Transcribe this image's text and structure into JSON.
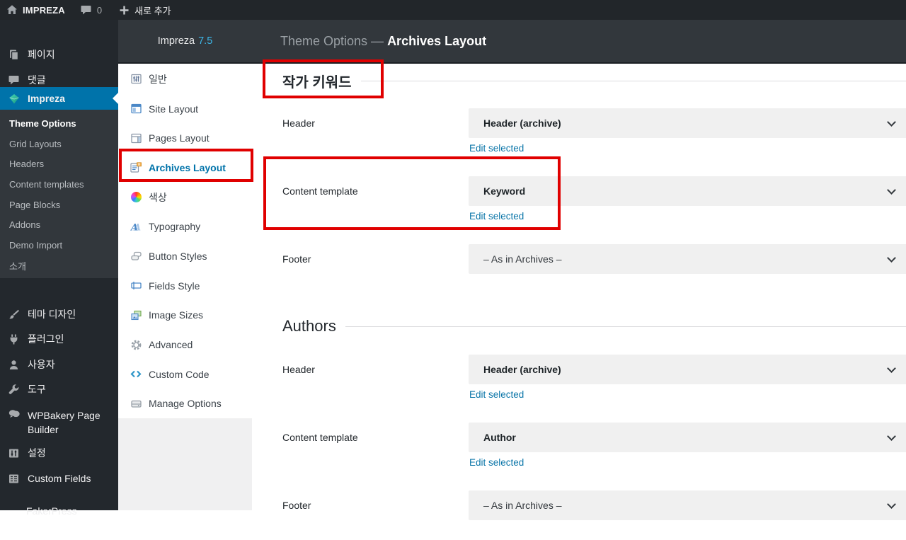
{
  "admin_bar": {
    "site_name": "IMPREZA",
    "comments_count": "0",
    "new_button": "새로 추가"
  },
  "admin_sidebar": {
    "top_items": [
      {
        "label": "페이지"
      },
      {
        "label": "댓글"
      }
    ],
    "impreza_label": "Impreza",
    "impreza_submenu": [
      "Theme Options",
      "Grid Layouts",
      "Headers",
      "Content templates",
      "Page Blocks",
      "Addons",
      "Demo Import",
      "소개"
    ],
    "active_submenu": "Theme Options",
    "lower_items": [
      {
        "label": "테마 디자인"
      },
      {
        "label": "플러그인"
      },
      {
        "label": "사용자"
      },
      {
        "label": "도구"
      },
      {
        "label": "WPBakery Page Builder"
      },
      {
        "label": "설정"
      },
      {
        "label": "Custom Fields"
      },
      {
        "label": "FakerPress"
      }
    ]
  },
  "theme_nav": {
    "brand": "Impreza",
    "version": "7.5",
    "items": [
      "일반",
      "Site Layout",
      "Pages Layout",
      "Archives Layout",
      "색상",
      "Typography",
      "Button Styles",
      "Fields Style",
      "Image Sizes",
      "Advanced",
      "Custom Code",
      "Manage Options"
    ],
    "active_item": "Archives Layout"
  },
  "page_header": {
    "prefix": "Theme Options — ",
    "title": "Archives Layout"
  },
  "sections": [
    {
      "title": "작가 키워드",
      "rows": [
        {
          "label": "Header",
          "value": "Header (archive)",
          "edit_link": "Edit selected"
        },
        {
          "label": "Content template",
          "value": "Keyword",
          "edit_link": "Edit selected"
        },
        {
          "label": "Footer",
          "value": "– As in Archives –"
        }
      ]
    },
    {
      "title": "Authors",
      "rows": [
        {
          "label": "Header",
          "value": "Header (archive)",
          "edit_link": "Edit selected"
        },
        {
          "label": "Content template",
          "value": "Author",
          "edit_link": "Edit selected"
        },
        {
          "label": "Footer",
          "value": "– As in Archives –"
        }
      ]
    }
  ],
  "annotations": {
    "color": "#e00000",
    "highlighted": [
      "작가 키워드 heading",
      "Archives Layout menu item",
      "Content template row"
    ]
  },
  "colors": {
    "accent_blue": "#0073aa",
    "link_blue": "#0a75a8",
    "admin_bar_bg": "#22262a",
    "sidebar_bg": "#23282d",
    "submenu_bg": "#32373c",
    "header_strip_bg": "#32373c",
    "select_bg": "#f0f0f0",
    "annotation_red": "#e00000",
    "version_blue": "#3db7e8"
  }
}
